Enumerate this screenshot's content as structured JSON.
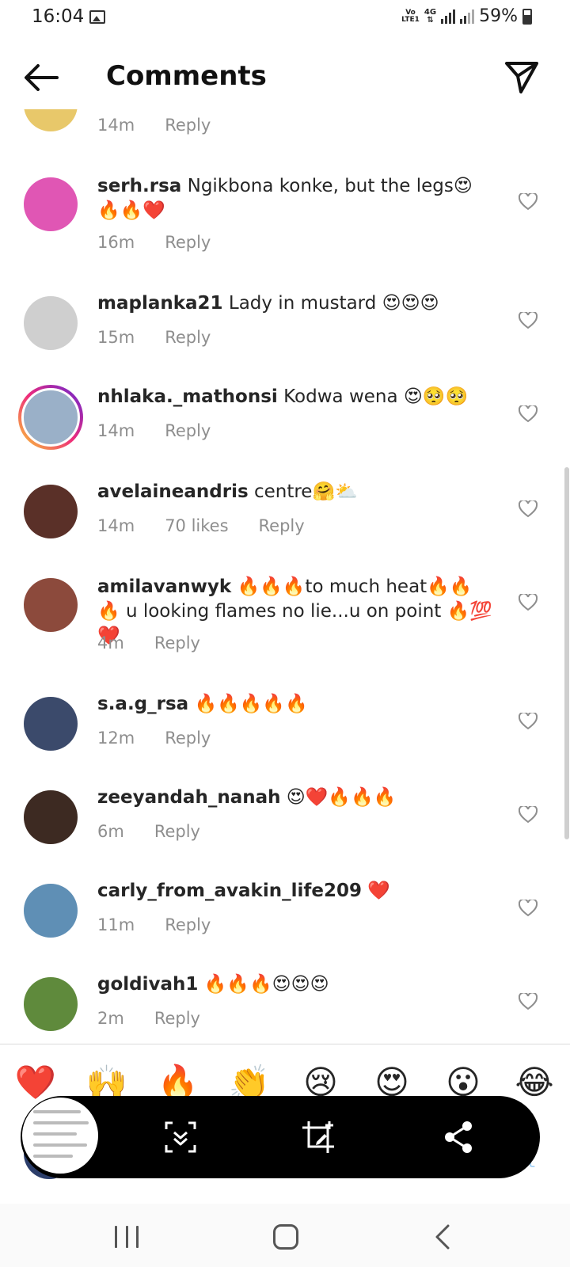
{
  "status_bar": {
    "time": "16:04",
    "volte": "Vo\nLTE1",
    "network": "4G",
    "battery": "59%"
  },
  "header": {
    "title": "Comments",
    "back_icon": "back-arrow-icon",
    "send_icon": "paper-plane-icon"
  },
  "comments": [
    {
      "user": "",
      "text": "",
      "time": "14m",
      "likes": "",
      "reply": "Reply",
      "avatar_color": "#e8c86a",
      "story": false,
      "partial": true
    },
    {
      "user": "serh.rsa",
      "text": " Ngikbona konke, but the legs😍🔥🔥❤️",
      "time": "16m",
      "likes": "",
      "reply": "Reply",
      "avatar_color": "#e056b4",
      "story": false
    },
    {
      "user": "maplanka21",
      "text": " Lady in mustard 😍😍😍",
      "time": "15m",
      "likes": "",
      "reply": "Reply",
      "avatar_color": "#cfcfcf",
      "story": false
    },
    {
      "user": "nhlaka._mathonsi",
      "text": " Kodwa wena 😍🥺🥺",
      "time": "14m",
      "likes": "",
      "reply": "Reply",
      "avatar_color": "#9ab0c8",
      "story": true
    },
    {
      "user": "avelaineandris",
      "text": " centre🤗⛅",
      "time": "14m",
      "likes": "70 likes",
      "reply": "Reply",
      "avatar_color": "#5a3028",
      "story": false
    },
    {
      "user": "amilavanwyk",
      "text": " 🔥🔥🔥to much heat🔥🔥🔥 u looking flames no lie...u on point 🔥💯❤️",
      "time": "4m",
      "likes": "",
      "reply": "Reply",
      "avatar_color": "#8c4a3c",
      "story": false
    },
    {
      "user": "s.a.g_rsa",
      "text": " 🔥🔥🔥🔥🔥",
      "time": "12m",
      "likes": "",
      "reply": "Reply",
      "avatar_color": "#3b4a6b",
      "story": false
    },
    {
      "user": "zeeyandah_nanah",
      "text": " 😍❤️🔥🔥🔥",
      "time": "6m",
      "likes": "",
      "reply": "Reply",
      "avatar_color": "#3d2a22",
      "story": false
    },
    {
      "user": "carly_from_avakin_life209",
      "text": " ❤️",
      "time": "11m",
      "likes": "",
      "reply": "Reply",
      "avatar_color": "#5f8fb5",
      "story": false
    },
    {
      "user": "goldivah1",
      "text": " 🔥🔥🔥😍😍😍",
      "time": "2m",
      "likes": "",
      "reply": "Reply",
      "avatar_color": "#5f8a3c",
      "story": false
    }
  ],
  "emoji_bar": [
    "❤️",
    "🙌",
    "🔥",
    "👏",
    "😢",
    "😍",
    "😮",
    "😂"
  ],
  "input": {
    "post_label": "st"
  },
  "capture_toolbar": {
    "icons": [
      "scroll-capture-icon",
      "crop-edit-icon",
      "share-icon"
    ]
  },
  "nav": {
    "icons": [
      "recents-icon",
      "home-icon",
      "back-icon"
    ]
  }
}
